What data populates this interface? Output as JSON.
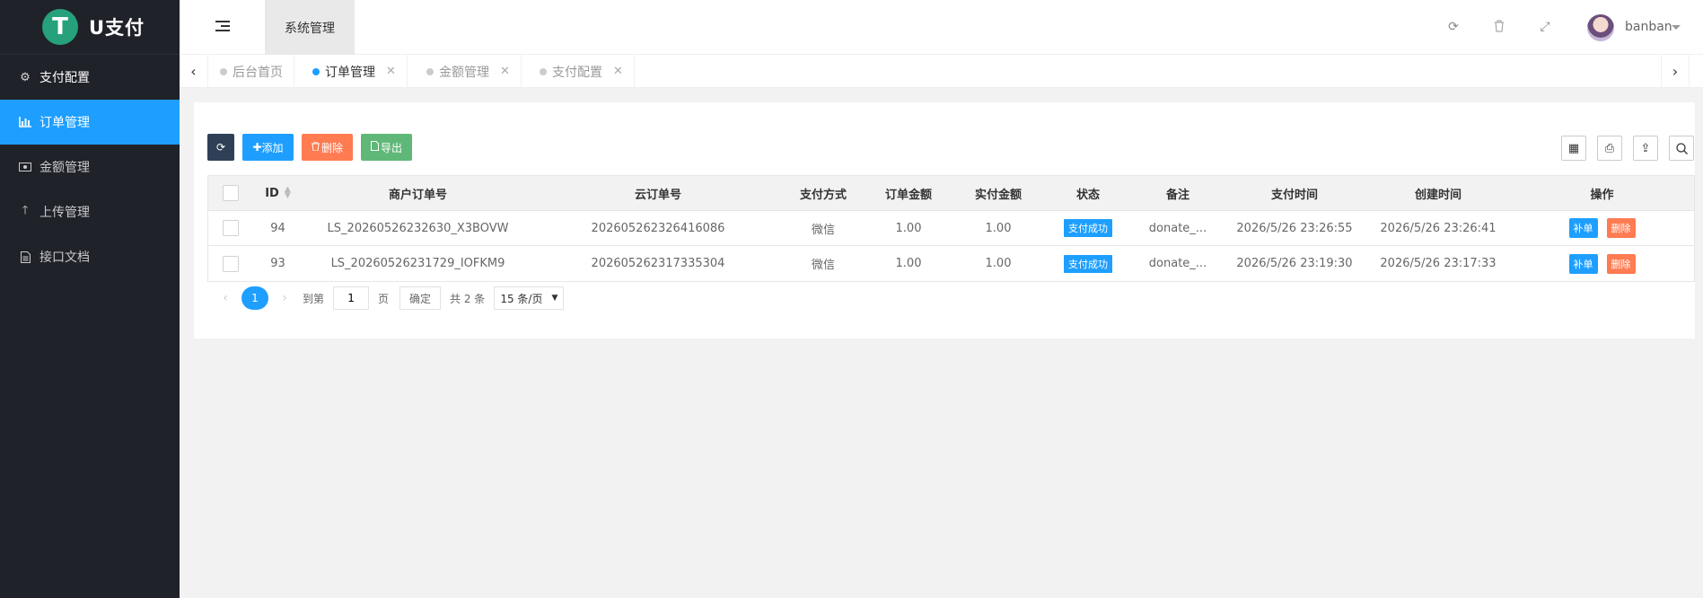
{
  "sidebar": {
    "logo_mark": "T",
    "logo_text": "U支付",
    "items": [
      {
        "label": "支付配置",
        "icon": "gears-icon"
      },
      {
        "label": "订单管理",
        "icon": "bar-chart-icon",
        "active": true
      },
      {
        "label": "金额管理",
        "icon": "money-icon"
      },
      {
        "label": "上传管理",
        "icon": "arrow-up-icon"
      },
      {
        "label": "接口文档",
        "icon": "document-icon"
      }
    ]
  },
  "header": {
    "system_tab": "系统管理",
    "username": "banban",
    "icons": [
      "refresh-icon",
      "trash-icon",
      "fullscreen-icon"
    ]
  },
  "tabs": [
    {
      "label": "后台首页",
      "closable": false
    },
    {
      "label": "订单管理",
      "closable": true,
      "active": true
    },
    {
      "label": "金额管理",
      "closable": true
    },
    {
      "label": "支付配置",
      "closable": true
    }
  ],
  "toolbar": {
    "add_label": "添加",
    "delete_label": "删除",
    "export_label": "导出"
  },
  "table": {
    "columns": [
      "ID",
      "商户订单号",
      "云订单号",
      "支付方式",
      "订单金额",
      "实付金额",
      "状态",
      "备注",
      "支付时间",
      "创建时间",
      "操作"
    ],
    "rows": [
      {
        "id": "94",
        "merchant_order": "LS_20260526232630_X3BOVW",
        "cloud_order": "202605262326416086",
        "pay_method": "微信",
        "amount": "1.00",
        "paid": "1.00",
        "status": "支付成功",
        "note": "donate_...",
        "pay_time": "2026/5/26 23:26:55",
        "create_time": "2026/5/26 23:26:41",
        "op_fix": "补单",
        "op_del": "删除"
      },
      {
        "id": "93",
        "merchant_order": "LS_20260526231729_IOFKM9",
        "cloud_order": "202605262317335304",
        "pay_method": "微信",
        "amount": "1.00",
        "paid": "1.00",
        "status": "支付成功",
        "note": "donate_...",
        "pay_time": "2026/5/26 23:19:30",
        "create_time": "2026/5/26 23:17:33",
        "op_fix": "补单",
        "op_del": "删除"
      }
    ]
  },
  "pager": {
    "current": "1",
    "goto_label": "到第",
    "goto_value": "1",
    "page_label": "页",
    "confirm_label": "确定",
    "total_label": "共 2 条",
    "page_size": "15 条/页"
  },
  "colors": {
    "sidebar_bg": "#20222a",
    "accent": "#1e9fff",
    "danger": "#ff5722",
    "success": "#5fb878"
  }
}
